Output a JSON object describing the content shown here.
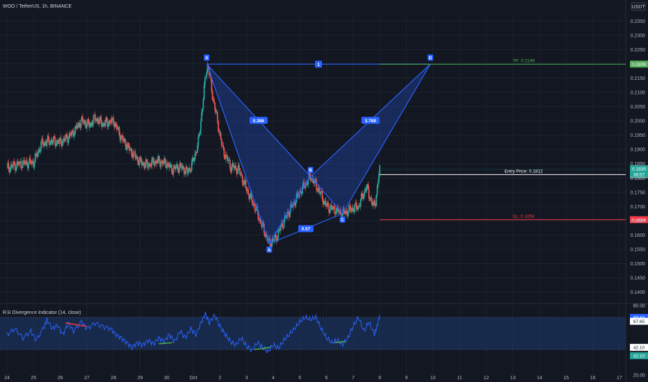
{
  "header": {
    "symbol_title": "WOO / TetherUS, 1h, BINANCE",
    "currency_badge": "USDT"
  },
  "colors": {
    "background": "#131722",
    "grid": "#1e222d",
    "candle_up": "#26a69a",
    "candle_down": "#ef5350",
    "pattern_line": "#2962ff",
    "pattern_fill": "#2962ff",
    "tp": "#4caf50",
    "sl": "#f23645",
    "entry": "#ffffff",
    "rsi_line": "#2962ff",
    "rsi_band": "#1e3a6e",
    "div_bear": "#f23645",
    "div_bull": "#4caf50",
    "text": "#b2b5be"
  },
  "chart_data": [
    {
      "type": "candlestick",
      "title": "WOO / TetherUS, 1h, BINANCE",
      "x_ticks": [
        "24",
        "25",
        "26",
        "27",
        "28",
        "29",
        "30",
        "Oct",
        "2",
        "3",
        "4",
        "5",
        "6",
        "7",
        "8",
        "9",
        "10",
        "11",
        "12",
        "13",
        "14",
        "15",
        "16",
        "17"
      ],
      "y_ticks": [
        "0.2350",
        "0.2300",
        "0.2250",
        "0.2200",
        "0.2150",
        "0.2100",
        "0.2050",
        "0.2000",
        "0.1950",
        "0.1900",
        "0.1850",
        "0.1800",
        "0.1750",
        "0.1700",
        "0.1650",
        "0.1600",
        "0.1550",
        "0.1500",
        "0.1450",
        "0.1400"
      ],
      "ylim": [
        0.1365,
        0.2375
      ],
      "close_path_key": [
        [
          0,
          0.1835
        ],
        [
          0.5,
          0.185
        ],
        [
          1.0,
          0.1855
        ],
        [
          1.3,
          0.192
        ],
        [
          1.6,
          0.193
        ],
        [
          2.0,
          0.1925
        ],
        [
          2.4,
          0.195
        ],
        [
          2.8,
          0.2
        ],
        [
          3.1,
          0.1985
        ],
        [
          3.3,
          0.201
        ],
        [
          3.6,
          0.199
        ],
        [
          4.0,
          0.2
        ],
        [
          4.3,
          0.194
        ],
        [
          4.6,
          0.19
        ],
        [
          5.0,
          0.1855
        ],
        [
          5.3,
          0.1845
        ],
        [
          5.6,
          0.186
        ],
        [
          5.8,
          0.1855
        ],
        [
          6.0,
          0.185
        ],
        [
          6.2,
          0.183
        ],
        [
          6.5,
          0.184
        ],
        [
          6.8,
          0.182
        ],
        [
          7.0,
          0.186
        ],
        [
          7.2,
          0.193
        ],
        [
          7.35,
          0.206
        ],
        [
          7.45,
          0.215
        ],
        [
          7.5,
          0.218
        ],
        [
          7.55,
          0.2199
        ],
        [
          7.7,
          0.21
        ],
        [
          7.9,
          0.2
        ],
        [
          8.1,
          0.19
        ],
        [
          8.4,
          0.184
        ],
        [
          8.7,
          0.183
        ],
        [
          9.0,
          0.176
        ],
        [
          9.3,
          0.17
        ],
        [
          9.55,
          0.164
        ],
        [
          9.85,
          0.157
        ],
        [
          10.1,
          0.159
        ],
        [
          10.4,
          0.165
        ],
        [
          10.7,
          0.17
        ],
        [
          11.0,
          0.175
        ],
        [
          11.4,
          0.1805
        ],
        [
          11.7,
          0.176
        ],
        [
          12.0,
          0.17
        ],
        [
          12.3,
          0.169
        ],
        [
          12.6,
          0.1675
        ],
        [
          12.9,
          0.169
        ],
        [
          13.2,
          0.17
        ],
        [
          13.5,
          0.177
        ],
        [
          13.75,
          0.17
        ],
        [
          13.85,
          0.172
        ],
        [
          13.95,
          0.18
        ],
        [
          14.0,
          0.183
        ]
      ],
      "harmonic_pattern": {
        "points": [
          {
            "label": "X",
            "x": 7.5,
            "y": 0.2199
          },
          {
            "label": "A",
            "x": 9.85,
            "y": 0.157
          },
          {
            "label": "B",
            "x": 11.4,
            "y": 0.1805
          },
          {
            "label": "C",
            "x": 12.6,
            "y": 0.1675
          },
          {
            "label": "D",
            "x": 15.9,
            "y": 0.2199
          }
        ],
        "ratios": [
          "0.386",
          "0.57",
          "3.789",
          "1"
        ]
      },
      "levels": [
        {
          "name": "TP",
          "label": "TP: 0.2199",
          "tag": "0.2199",
          "y": 0.2199
        },
        {
          "name": "Entry",
          "label": "Entry Price: 0.1812",
          "tag": "0.1812",
          "y": 0.1812
        },
        {
          "name": "SL",
          "label": "SL: 0.1654",
          "tag": "0.1654",
          "y": 0.1654
        }
      ],
      "last_price": {
        "value": "0.1830",
        "countdown": "36:57",
        "y": 0.183
      }
    },
    {
      "type": "line",
      "title": "RSI Divergence Indicator (14, close)",
      "y_ticks": [
        "80.00",
        "20.00"
      ],
      "ylim": [
        20,
        80
      ],
      "band": [
        42.1,
        69.83
      ],
      "tags": [
        "69.83",
        "67.65",
        "42.10",
        "42.10"
      ],
      "points": [
        [
          0,
          55
        ],
        [
          0.3,
          60
        ],
        [
          0.6,
          52
        ],
        [
          0.9,
          58
        ],
        [
          1.1,
          50
        ],
        [
          1.4,
          62
        ],
        [
          1.5,
          68
        ],
        [
          1.7,
          60
        ],
        [
          1.9,
          63
        ],
        [
          2.1,
          55
        ],
        [
          2.3,
          65
        ],
        [
          2.5,
          58
        ],
        [
          2.8,
          66
        ],
        [
          3.0,
          60
        ],
        [
          3.3,
          65
        ],
        [
          3.6,
          62
        ],
        [
          3.9,
          60
        ],
        [
          4.1,
          55
        ],
        [
          4.3,
          52
        ],
        [
          4.5,
          48
        ],
        [
          4.7,
          44
        ],
        [
          4.9,
          48
        ],
        [
          5.1,
          46
        ],
        [
          5.3,
          50
        ],
        [
          5.5,
          47
        ],
        [
          5.7,
          52
        ],
        [
          5.9,
          49
        ],
        [
          6.1,
          55
        ],
        [
          6.3,
          49
        ],
        [
          6.5,
          58
        ],
        [
          6.7,
          52
        ],
        [
          6.9,
          60
        ],
        [
          7.1,
          55
        ],
        [
          7.3,
          66
        ],
        [
          7.45,
          73
        ],
        [
          7.6,
          65
        ],
        [
          7.8,
          72
        ],
        [
          8.0,
          62
        ],
        [
          8.2,
          55
        ],
        [
          8.4,
          49
        ],
        [
          8.6,
          46
        ],
        [
          8.8,
          52
        ],
        [
          9.0,
          45
        ],
        [
          9.2,
          41
        ],
        [
          9.4,
          48
        ],
        [
          9.6,
          44
        ],
        [
          9.8,
          40
        ],
        [
          10.0,
          46
        ],
        [
          10.2,
          43
        ],
        [
          10.4,
          50
        ],
        [
          10.6,
          55
        ],
        [
          10.8,
          60
        ],
        [
          11.0,
          66
        ],
        [
          11.2,
          70
        ],
        [
          11.4,
          68
        ],
        [
          11.6,
          70
        ],
        [
          11.8,
          60
        ],
        [
          12.0,
          52
        ],
        [
          12.2,
          48
        ],
        [
          12.4,
          50
        ],
        [
          12.6,
          46
        ],
        [
          12.8,
          52
        ],
        [
          13.0,
          62
        ],
        [
          13.2,
          70
        ],
        [
          13.4,
          58
        ],
        [
          13.6,
          66
        ],
        [
          13.8,
          55
        ],
        [
          13.9,
          62
        ],
        [
          14.0,
          72
        ]
      ],
      "divergence_lines": [
        {
          "kind": "bear",
          "from": [
            2.2,
            65
          ],
          "to": [
            3.0,
            62
          ]
        },
        {
          "kind": "bull",
          "from": [
            5.7,
            47
          ],
          "to": [
            6.2,
            48
          ]
        },
        {
          "kind": "bull",
          "from": [
            9.3,
            42
          ],
          "to": [
            9.9,
            44
          ]
        },
        {
          "kind": "bull",
          "from": [
            12.3,
            48
          ],
          "to": [
            12.7,
            49
          ]
        }
      ]
    }
  ]
}
